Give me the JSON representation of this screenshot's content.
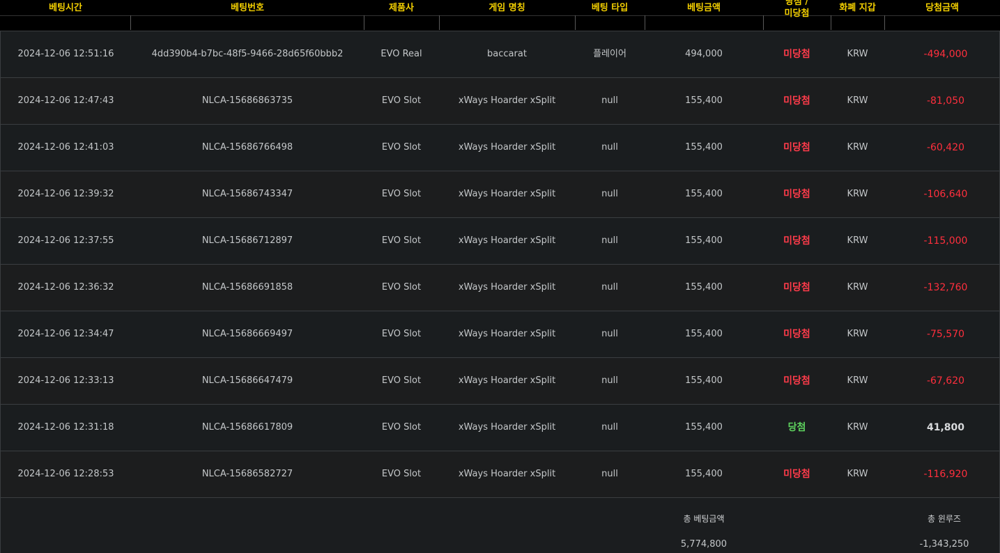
{
  "headers": {
    "bet_time": "베팅시간",
    "bet_no": "베팅번호",
    "provider": "제품사",
    "game": "게임 명칭",
    "bet_type": "베팅 타입",
    "bet_amount": "베팅금액",
    "result_line1": "당첨 /",
    "result_line2": "미당첨",
    "currency": "화폐 지갑",
    "win_amount": "당첨금액"
  },
  "rows": [
    {
      "time": "2024-12-06 12:51:16",
      "bet_no": "4dd390b4-b7bc-48f5-9466-28d65f60bbb2",
      "provider": "EVO Real",
      "game": "baccarat",
      "bet_type": "플레이어",
      "amount": "494,000",
      "result": "미당첨",
      "currency": "KRW",
      "win": "-494,000"
    },
    {
      "time": "2024-12-06 12:47:43",
      "bet_no": "NLCA-15686863735",
      "provider": "EVO Slot",
      "game": "xWays Hoarder xSplit",
      "bet_type": "null",
      "amount": "155,400",
      "result": "미당첨",
      "currency": "KRW",
      "win": "-81,050"
    },
    {
      "time": "2024-12-06 12:41:03",
      "bet_no": "NLCA-15686766498",
      "provider": "EVO Slot",
      "game": "xWays Hoarder xSplit",
      "bet_type": "null",
      "amount": "155,400",
      "result": "미당첨",
      "currency": "KRW",
      "win": "-60,420"
    },
    {
      "time": "2024-12-06 12:39:32",
      "bet_no": "NLCA-15686743347",
      "provider": "EVO Slot",
      "game": "xWays Hoarder xSplit",
      "bet_type": "null",
      "amount": "155,400",
      "result": "미당첨",
      "currency": "KRW",
      "win": "-106,640"
    },
    {
      "time": "2024-12-06 12:37:55",
      "bet_no": "NLCA-15686712897",
      "provider": "EVO Slot",
      "game": "xWays Hoarder xSplit",
      "bet_type": "null",
      "amount": "155,400",
      "result": "미당첨",
      "currency": "KRW",
      "win": "-115,000"
    },
    {
      "time": "2024-12-06 12:36:32",
      "bet_no": "NLCA-15686691858",
      "provider": "EVO Slot",
      "game": "xWays Hoarder xSplit",
      "bet_type": "null",
      "amount": "155,400",
      "result": "미당첨",
      "currency": "KRW",
      "win": "-132,760"
    },
    {
      "time": "2024-12-06 12:34:47",
      "bet_no": "NLCA-15686669497",
      "provider": "EVO Slot",
      "game": "xWays Hoarder xSplit",
      "bet_type": "null",
      "amount": "155,400",
      "result": "미당첨",
      "currency": "KRW",
      "win": "-75,570"
    },
    {
      "time": "2024-12-06 12:33:13",
      "bet_no": "NLCA-15686647479",
      "provider": "EVO Slot",
      "game": "xWays Hoarder xSplit",
      "bet_type": "null",
      "amount": "155,400",
      "result": "미당첨",
      "currency": "KRW",
      "win": "-67,620"
    },
    {
      "time": "2024-12-06 12:31:18",
      "bet_no": "NLCA-15686617809",
      "provider": "EVO Slot",
      "game": "xWays Hoarder xSplit",
      "bet_type": "null",
      "amount": "155,400",
      "result": "당첨",
      "currency": "KRW",
      "win": "41,800"
    },
    {
      "time": "2024-12-06 12:28:53",
      "bet_no": "NLCA-15686582727",
      "provider": "EVO Slot",
      "game": "xWays Hoarder xSplit",
      "bet_type": "null",
      "amount": "155,400",
      "result": "미당첨",
      "currency": "KRW",
      "win": "-116,920"
    }
  ],
  "footer": {
    "total_bet_label": "총 베팅금액",
    "total_bet_value": "5,774,800",
    "total_winloss_label": "총 윈루즈",
    "total_winloss_value": "-1,343,250"
  },
  "colors": {
    "header_text": "#f4d000",
    "lose": "#ff3b4a",
    "win": "#5ed35e",
    "negative_amount": "#ff2f3d"
  }
}
